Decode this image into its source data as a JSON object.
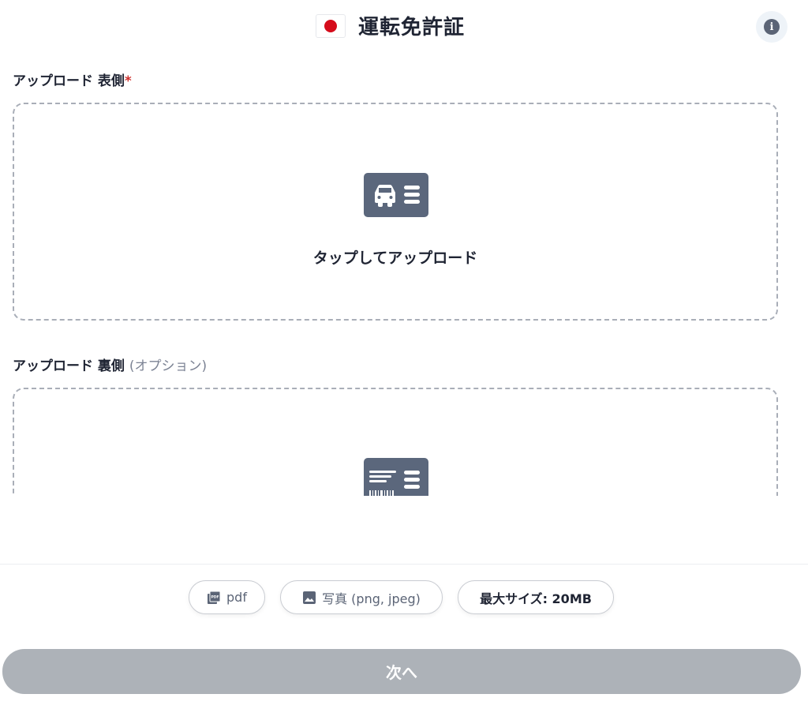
{
  "header": {
    "flag_icon": "japan-flag-icon",
    "title": "運転免許証",
    "info_icon": "info-icon"
  },
  "front": {
    "label": "アップロード 表側",
    "required_mark": "*",
    "icon": "driver-license-front-icon",
    "upload_text": "タップしてアップロード"
  },
  "back": {
    "label": "アップロード 裏側",
    "optional_text": "(オプション)",
    "icon": "driver-license-back-icon"
  },
  "formats": {
    "pdf_label": "pdf",
    "pdf_icon": "pdf-file-icon",
    "photo_label": "写真 (png, jpeg)",
    "photo_icon": "image-icon",
    "max_size_label": "最大サイズ: 20MB"
  },
  "footer": {
    "next_label": "次へ"
  },
  "colors": {
    "accent_disabled": "#adb2b8",
    "icon_fill": "#5b677c",
    "required": "#d0322f",
    "flag_red": "#d50c1b"
  }
}
